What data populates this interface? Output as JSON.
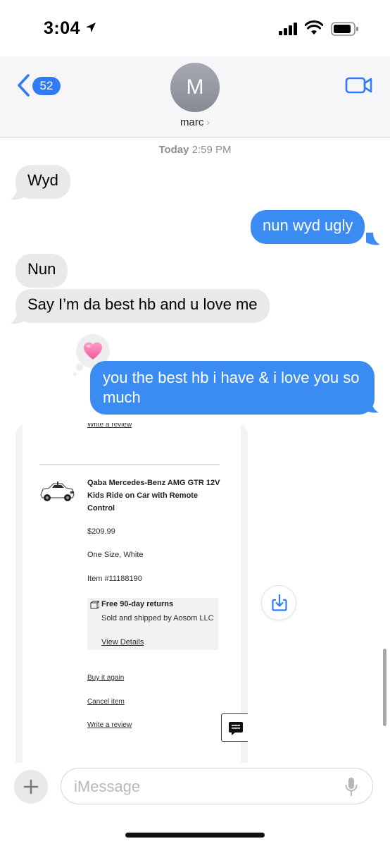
{
  "status_bar": {
    "time": "3:04"
  },
  "header": {
    "back_count": "52",
    "avatar_initial": "M",
    "contact_name": "marc",
    "chevron": "›"
  },
  "conversation": {
    "timestamp_day": "Today",
    "timestamp_time": "2:59 PM",
    "messages": [
      {
        "from": "them",
        "text": "Wyd"
      },
      {
        "from": "me",
        "text": "nun wyd ugly"
      },
      {
        "from": "them",
        "text": "Nun"
      },
      {
        "from": "them",
        "text": "Say I’m da best hb and u love me"
      },
      {
        "from": "me",
        "text": "you the best hb i have & i love you so much",
        "tapback": "pink-heart"
      }
    ]
  },
  "screenshot_card": {
    "link_top": "Write a review",
    "product_title": "Qaba Mercedes-Benz AMG GTR 12V Kids Ride on Car with Remote Control",
    "price": "$209.99",
    "variant": "One Size, White",
    "item_number": "Item #11188190",
    "returns_title": "Free 90-day returns",
    "sold_by": "Sold and shipped by Aosom LLC",
    "view_details": "View Details",
    "buy_again": "Buy it again",
    "cancel_item": "Cancel item",
    "write_review": "Write a review"
  },
  "composer": {
    "placeholder": "iMessage"
  },
  "colors": {
    "accent": "#3b8cf2",
    "incoming_bubble": "#e9e9eb",
    "badge": "#2f7cf6"
  }
}
